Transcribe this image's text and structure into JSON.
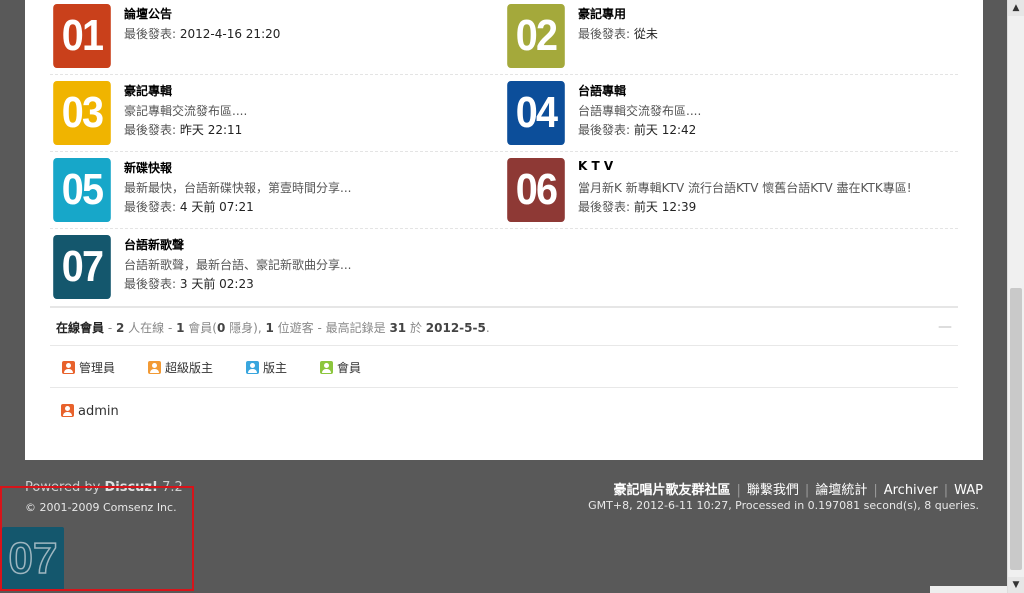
{
  "forums": [
    {
      "num": "01",
      "color": "#c9401b",
      "title": "論壇公告",
      "desc": "",
      "last_label": "最後發表:",
      "last_value": "2012-4-16 21:20"
    },
    {
      "num": "02",
      "color": "#a4a93b",
      "title": "豪記專用",
      "desc": "",
      "last_label": "最後發表:",
      "last_value": "從未"
    },
    {
      "num": "03",
      "color": "#f0b400",
      "title": "豪記專輯",
      "desc": "豪記專輯交流發布區....",
      "last_label": "最後發表:",
      "last_value": "昨天 22:11"
    },
    {
      "num": "04",
      "color": "#0c4e9a",
      "title": "台語專輯",
      "desc": "台語專輯交流發布區....",
      "last_label": "最後發表:",
      "last_value": "前天 12:42"
    },
    {
      "num": "05",
      "color": "#17a7c9",
      "title": "新碟快報",
      "desc": "最新最快，台語新碟快報，第壹時間分享...",
      "last_label": "最後發表:",
      "last_value": "4 天前 07:21"
    },
    {
      "num": "06",
      "color": "#8e3935",
      "title": "K T V",
      "desc": "當月新K 新專輯KTV 流行台語KTV 懷舊台語KTV 盡在KTK專區!",
      "last_label": "最後發表:",
      "last_value": "前天 12:39"
    },
    {
      "num": "07",
      "color": "#14576d",
      "title": "台語新歌聲",
      "desc": "台語新歌聲，最新台語、豪記新歌曲分享...",
      "last_label": "最後發表:",
      "last_value": "3 天前 02:23"
    }
  ],
  "online": {
    "label": "在線會員",
    "t1": " - ",
    "n1": "2",
    "t2": " 人在線 - ",
    "n2": "1",
    "t3": " 會員(",
    "n3": "0",
    "t4": " 隱身), ",
    "n4": "1",
    "t5": " 位遊客 - 最高記錄是 ",
    "n5": "31",
    "t6": " 於 ",
    "n6": "2012-5-5",
    "t7": ".",
    "collapse_symbol": "—"
  },
  "legend": [
    {
      "label": "管理員",
      "color": "#e8622c"
    },
    {
      "label": "超級版主",
      "color": "#f29a35"
    },
    {
      "label": "版主",
      "color": "#39a6de"
    },
    {
      "label": "會員",
      "color": "#8cc63e"
    }
  ],
  "users": [
    {
      "name": "admin",
      "color": "#e8622c"
    }
  ],
  "footer": {
    "powered_prefix": "Powered by ",
    "powered_name": "Discuz!",
    "powered_version": " 7.2",
    "copyright": "© 2001-2009 Comsenz Inc.",
    "site_name": "豪記唱片歌友群社區",
    "links": [
      "聯繫我們",
      "論壇統計",
      "Archiver",
      "WAP"
    ],
    "meta": "GMT+8, 2012-6-11 10:27, Processed in 0.197081 second(s), 8 queries."
  },
  "floating_tile": "07",
  "scrollbar": {
    "up": "▲",
    "down": "▼"
  }
}
